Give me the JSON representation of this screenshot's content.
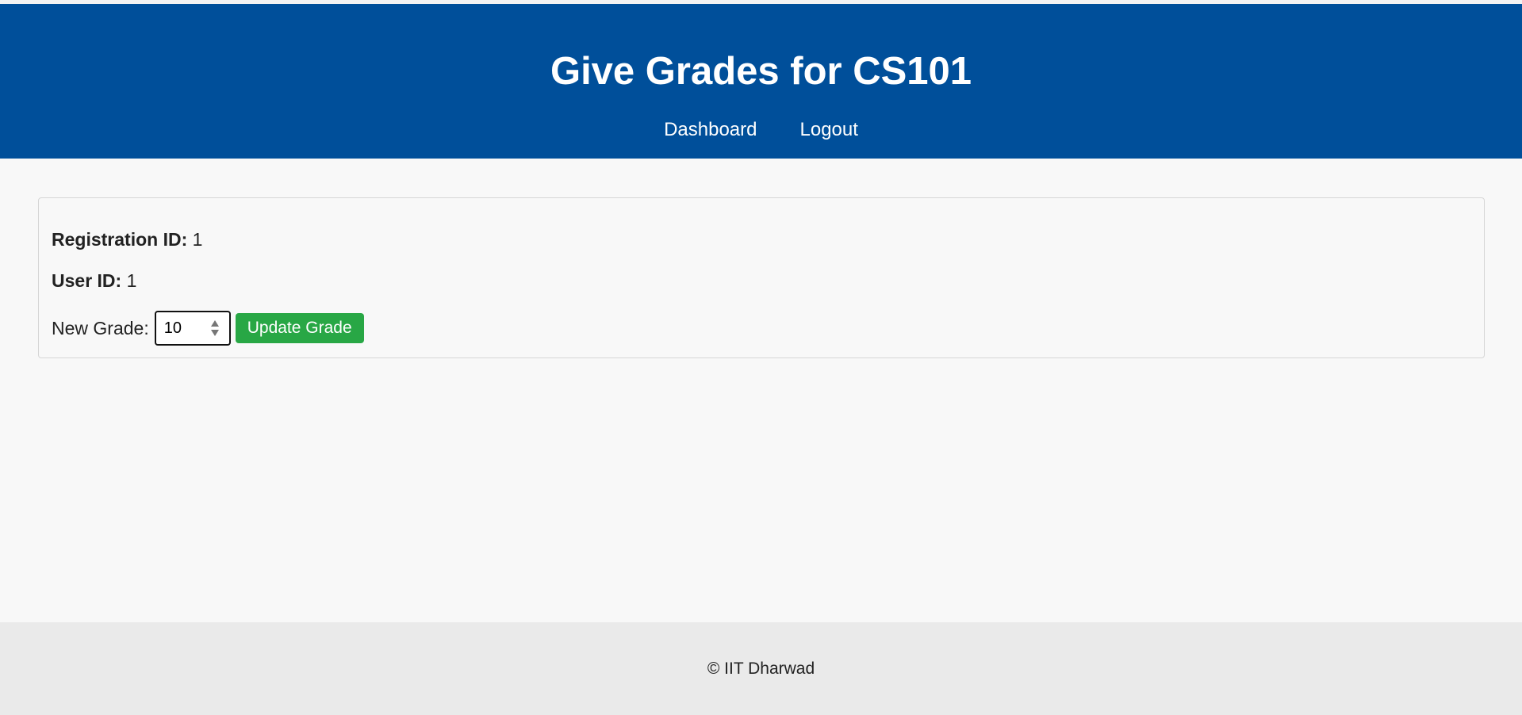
{
  "header": {
    "title": "Give Grades for CS101",
    "nav": [
      {
        "label": "Dashboard"
      },
      {
        "label": "Logout"
      }
    ]
  },
  "card": {
    "registration_label": "Registration ID:",
    "registration_value": "1",
    "user_label": "User ID:",
    "user_value": "1",
    "grade_label": "New Grade:",
    "grade_value": "10",
    "update_button": "Update Grade"
  },
  "footer": {
    "text": "© IIT Dharwad"
  },
  "colors": {
    "header_bg": "#004f9a",
    "button_bg": "#28a745",
    "footer_bg": "#eaeaea"
  }
}
